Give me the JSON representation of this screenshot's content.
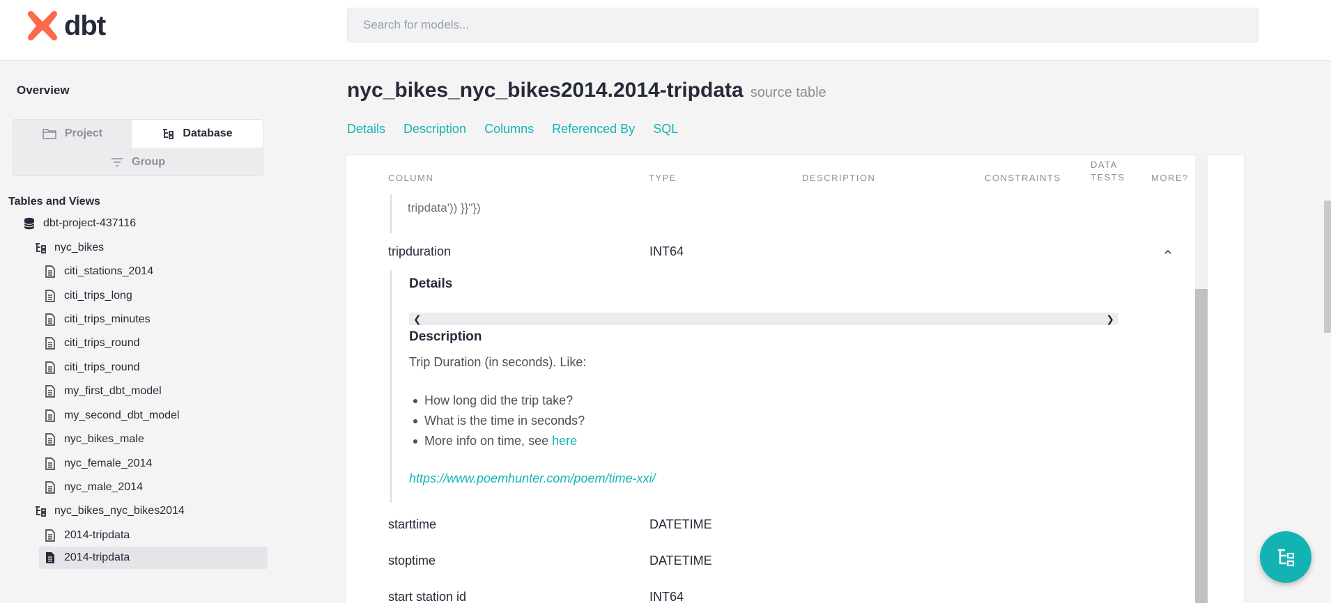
{
  "app": {
    "logo_text": "dbt",
    "brand_color": "#ff694b",
    "accent_color": "#14b3b3"
  },
  "search": {
    "placeholder": "Search for models..."
  },
  "sidebar": {
    "overview_label": "Overview",
    "switcher": {
      "project": "Project",
      "database": "Database",
      "group": "Group",
      "active": "Database"
    },
    "tables_title": "Tables and Views",
    "tree": [
      {
        "label": "dbt-project-437116",
        "icon": "database-icon"
      },
      {
        "label": "nyc_bikes",
        "icon": "schema-tree-icon"
      },
      {
        "label": "citi_stations_2014",
        "icon": "file-icon"
      },
      {
        "label": "citi_trips_long",
        "icon": "file-icon"
      },
      {
        "label": "citi_trips_minutes",
        "icon": "file-icon"
      },
      {
        "label": "citi_trips_round",
        "icon": "file-icon"
      },
      {
        "label": "citi_trips_round",
        "icon": "file-icon"
      },
      {
        "label": "my_first_dbt_model",
        "icon": "file-icon"
      },
      {
        "label": "my_second_dbt_model",
        "icon": "file-icon"
      },
      {
        "label": "nyc_bikes_male",
        "icon": "file-icon"
      },
      {
        "label": "nyc_female_2014",
        "icon": "file-icon"
      },
      {
        "label": "nyc_male_2014",
        "icon": "file-icon"
      },
      {
        "label": "nyc_bikes_nyc_bikes2014",
        "icon": "schema-tree-icon"
      },
      {
        "label": "2014-tripdata",
        "icon": "file-icon"
      },
      {
        "label": "2014-tripdata",
        "icon": "file-filled-icon",
        "selected": true
      }
    ]
  },
  "main": {
    "title": "nyc_bikes_nyc_bikes2014.2014-tripdata",
    "kind": "source table",
    "tabs": [
      "Details",
      "Description",
      "Columns",
      "Referenced By",
      "SQL"
    ],
    "columns_header": {
      "column": "COLUMN",
      "type": "TYPE",
      "description": "DESCRIPTION",
      "constraints": "CONSTRAINTS",
      "data_tests_line1": "DATA",
      "data_tests_line2": "TESTS",
      "more": "MORE?"
    },
    "leftover_text": "tripdata')) }}\"})",
    "rows": [
      {
        "name": "tripduration",
        "type": "INT64",
        "expanded": true
      },
      {
        "name": "starttime",
        "type": "DATETIME"
      },
      {
        "name": "stoptime",
        "type": "DATETIME"
      },
      {
        "name": "start station id",
        "type": "INT64"
      }
    ],
    "expanded_detail": {
      "details_title": "Details",
      "description_title": "Description",
      "description_text": "Trip Duration (in seconds). Like:",
      "bullets": [
        {
          "text": "How long did the trip take?"
        },
        {
          "text": "What is the time in seconds?"
        },
        {
          "text": "More info on time, see",
          "link": "here"
        }
      ],
      "link": "https://www.poemhunter.com/poem/time-xxi/"
    }
  }
}
